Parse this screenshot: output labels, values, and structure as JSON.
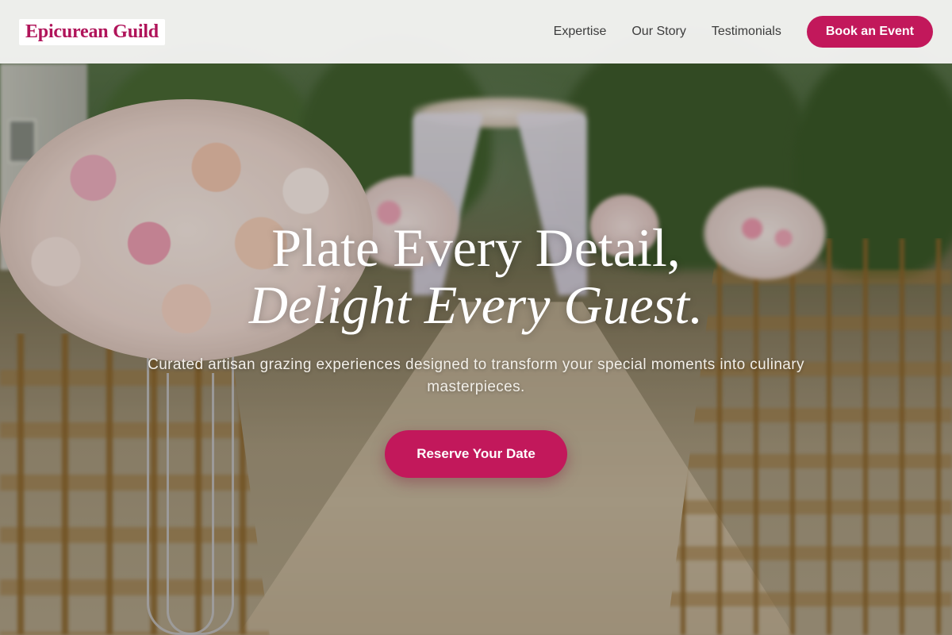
{
  "header": {
    "logo": "Epicurean Guild",
    "nav": [
      {
        "label": "Expertise"
      },
      {
        "label": "Our Story"
      },
      {
        "label": "Testimonials"
      }
    ],
    "cta_label": "Book an Event"
  },
  "hero": {
    "title_line1": "Plate Every Detail,",
    "title_line2": "Delight Every Guest.",
    "subtitle": "Curated artisan grazing experiences designed to transform your special moments into culinary masterpieces.",
    "cta_label": "Reserve Your Date",
    "background_image": "outdoor-wedding-ceremony-aisle-with-flower-arrangements-and-chairs"
  },
  "colors": {
    "accent": "#c2185b",
    "logo": "#b0145a",
    "header_bg": "#f4f4f2"
  }
}
